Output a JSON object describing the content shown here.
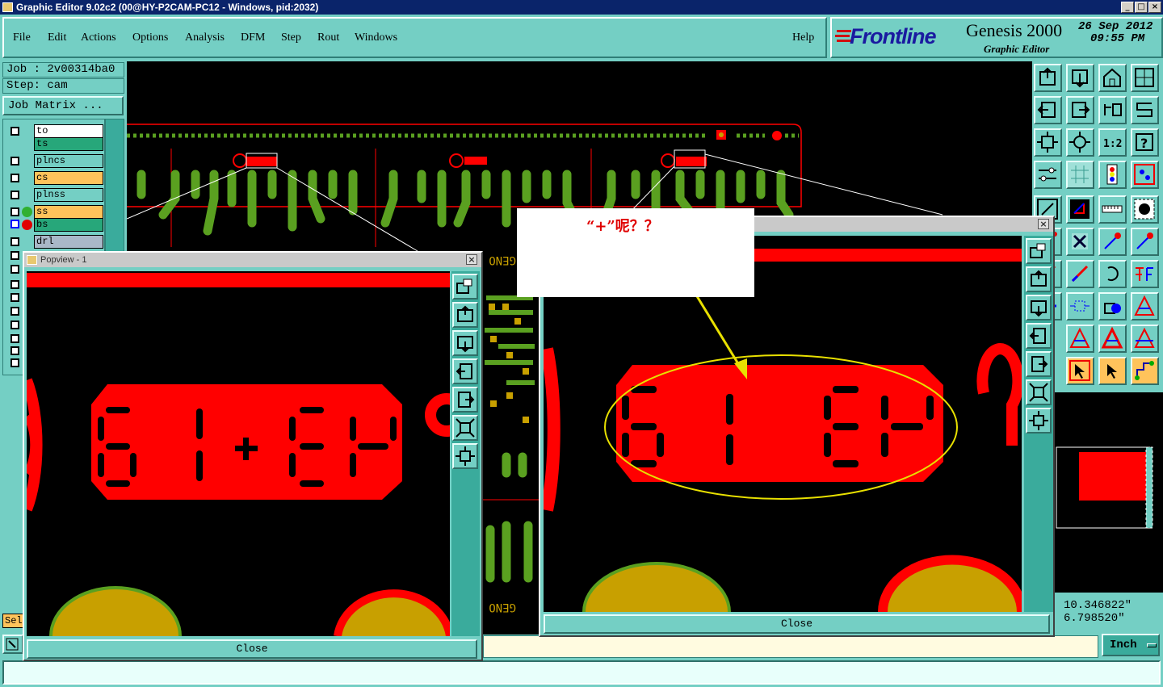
{
  "window": {
    "title": "Graphic Editor 9.02c2 (00@HY-P2CAM-PC12 - Windows, pid:2032)"
  },
  "menu": [
    "File",
    "Edit",
    "Actions",
    "Options",
    "Analysis",
    "DFM",
    "Step",
    "Rout",
    "Windows"
  ],
  "help_label": "Help",
  "brand": {
    "logo": "Frontline",
    "product": "Genesis 2000",
    "subtitle": "Graphic Editor",
    "date": "26 Sep 2012",
    "time": "09:55 PM"
  },
  "job": {
    "job_label": "Job : 2v00314ba0",
    "step_label": "Step: cam",
    "matrix_button": "Job Matrix ..."
  },
  "layers": [
    {
      "name": "to",
      "color": "#ffffff"
    },
    {
      "name": "ts",
      "color": "#27a77a"
    },
    {
      "name": "plncs",
      "color": "#74cfc4"
    },
    {
      "name": "cs",
      "color": "#ffc35b"
    },
    {
      "name": "plnss",
      "color": "#74cfc4"
    },
    {
      "name": "ss",
      "color": "#ffc35b"
    },
    {
      "name": "bs",
      "color": "#27a77a"
    },
    {
      "name": "drl",
      "color": "#a9b8c8"
    }
  ],
  "popview1": {
    "title": "Popview - 1",
    "close": "Close"
  },
  "popview2": {
    "close": "Close"
  },
  "annotation": {
    "text": "“+”呢？？"
  },
  "coords": {
    "x": "10.346822\"",
    "y": "6.798520\""
  },
  "units": {
    "label": "Inch"
  },
  "side_label": "Sel",
  "colors": {
    "board_red": "#ff0000",
    "trace_green": "#5aa020",
    "pad_yellow": "#c8a000",
    "panel_teal": "#74cfc4"
  }
}
